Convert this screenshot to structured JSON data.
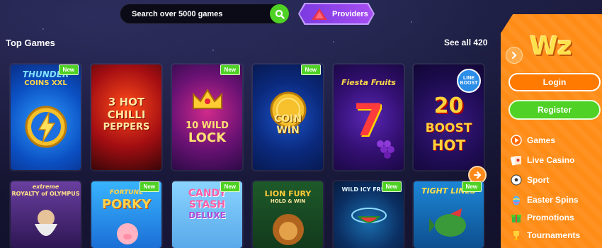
{
  "search": {
    "placeholder": "Search over 5000 games",
    "icon": "search-icon"
  },
  "providers": {
    "label": "Providers"
  },
  "section": {
    "title": "Top Games",
    "see_all": "See all 420"
  },
  "games": [
    {
      "title": "THUNDER COINS XXL",
      "badge": "New"
    },
    {
      "title": "3 HOT CHILLI PEPPERS",
      "badge": ""
    },
    {
      "title": "10 WILD LOCK",
      "badge": "New"
    },
    {
      "title": "COIN WIN",
      "badge": "New"
    },
    {
      "title": "Fiesta Fruits",
      "badge": ""
    },
    {
      "title": "20 BOOST HOT",
      "badge": ""
    },
    {
      "title": "extreme ROYALTY of OLYMPUS",
      "badge": ""
    },
    {
      "title": "FORTUNE PORKY",
      "badge": "New"
    },
    {
      "title": "CANDY STASH DELUXE",
      "badge": "New"
    },
    {
      "title": "LION FURY HOLD & WIN",
      "badge": ""
    },
    {
      "title": "WILD ICY FRUITS",
      "badge": "New"
    },
    {
      "title": "TIGHT LINES",
      "badge": "New"
    }
  ],
  "game_texts": {
    "g0a": "THUNDER",
    "g0b": "COINS XXL",
    "g1a": "3 HOT",
    "g1b": "CHILLI",
    "g1c": "PEPPERS",
    "g2a": "10 WILD",
    "g2b": "LOCK",
    "g3a": "COIN",
    "g3b": "WIN",
    "g4a": "Fiesta Fruits",
    "g4b": "7",
    "g5a": "LINE BOOST",
    "g5b": "20",
    "g5c": "BOOST",
    "g5d": "HOT",
    "g6a": "extreme",
    "g6b": "ROYALTY of OLYMPUS",
    "g7a": "FORTUNE",
    "g7b": "PORKY",
    "g8a": "CANDY",
    "g8b": "STASH",
    "g8c": "DELUXE",
    "g9a": "LION FURY",
    "g9b": "HOLD & WIN",
    "g10a": "WILD ICY FRUITS",
    "g11a": "TIGHT LINES"
  },
  "sidebar": {
    "logo": "Wz",
    "login": "Login",
    "register": "Register",
    "nav": [
      {
        "label": "Games",
        "icon": "play-icon"
      },
      {
        "label": "Live Casino",
        "icon": "cards-icon"
      },
      {
        "label": "Sport",
        "icon": "soccer-ball-icon"
      },
      {
        "label": "Easter Spins",
        "icon": "easter-egg-icon"
      },
      {
        "label": "Promotions",
        "icon": "gift-icon"
      },
      {
        "label": "Tournaments",
        "icon": "trophy-icon"
      }
    ]
  },
  "colors": {
    "accent_green": "#4fd125",
    "panel_orange": "#ff8c16",
    "providers_purple": "#8d42e8"
  }
}
